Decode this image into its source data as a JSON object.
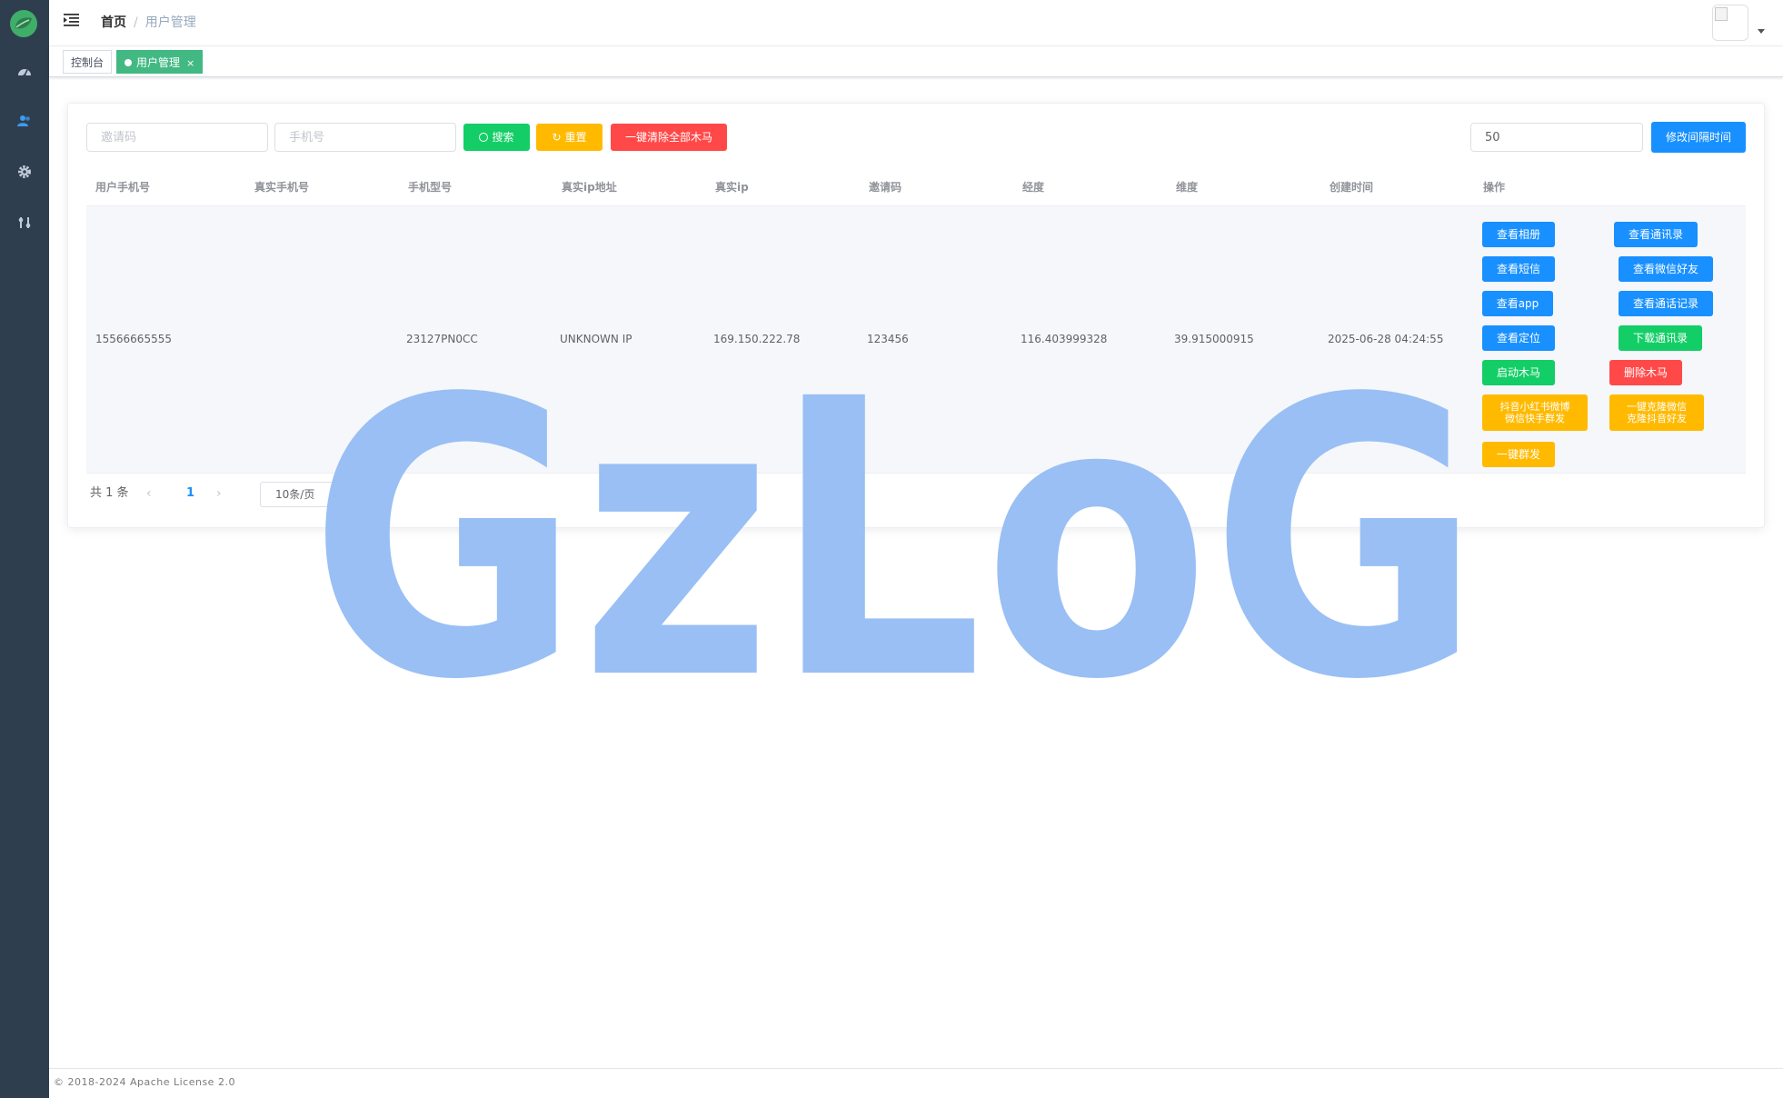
{
  "breadcrumb": {
    "home": "首页",
    "separator": "/",
    "current": "用户管理"
  },
  "tags": [
    {
      "label": "控制台",
      "active": false
    },
    {
      "label": "用户管理",
      "active": true,
      "close": "×"
    }
  ],
  "toolbar": {
    "invite_placeholder": "邀请码",
    "phone_placeholder": "手机号",
    "search_label": "搜索",
    "reset_label": "重置",
    "clear_all_label": "一键清除全部木马",
    "interval_value": "50",
    "modify_interval_label": "修改间隔时间"
  },
  "table": {
    "columns": [
      "用户手机号",
      "真实手机号",
      "手机型号",
      "真实ip地址",
      "真实ip",
      "邀请码",
      "经度",
      "维度",
      "创建时间",
      "操作"
    ],
    "rows": [
      {
        "user_phone": "15566665555",
        "real_phone": "",
        "model": "23127PN0CC",
        "ip_address": "UNKNOWN IP",
        "ip": "169.150.222.78",
        "invite_code": "123456",
        "longitude": "116.403999328",
        "latitude": "39.915000915",
        "created": "2025-06-28 04:24:55"
      }
    ],
    "actions": {
      "album": "查看相册",
      "contacts": "查看通讯录",
      "sms": "查看短信",
      "wechat_friends": "查看微信好友",
      "app": "查看app",
      "call_log": "查看通话记录",
      "location": "查看定位",
      "download_contacts": "下载通讯录",
      "start_trojan": "启动木马",
      "delete_trojan": "删除木马",
      "social_mass_line1": "抖音小红书微博",
      "social_mass_line2": "微信快手群发",
      "clone_line1": "一键克隆微信",
      "clone_line2": "克隆抖音好友",
      "mass_send": "一键群发"
    }
  },
  "pagination": {
    "total": "共 1 条",
    "prev": "‹",
    "page": "1",
    "next": "›",
    "page_size": "10条/页"
  },
  "watermark": "GzLoG",
  "footer": "© 2018-2024 Apache License 2.0",
  "colors": {
    "sidebar": "#2f3e4f",
    "accent_blue": "#1890ff",
    "green": "#13ce66",
    "yellow": "#ffba00",
    "red": "#ff4949",
    "tag_active": "#42b983",
    "watermark": "#93bcf3"
  },
  "icons": [
    "logo-leaf-icon",
    "dashboard-icon",
    "users-icon",
    "settings-icon",
    "tools-icon",
    "menu-fold-icon",
    "search-icon",
    "refresh-icon",
    "chevron-down-icon"
  ]
}
